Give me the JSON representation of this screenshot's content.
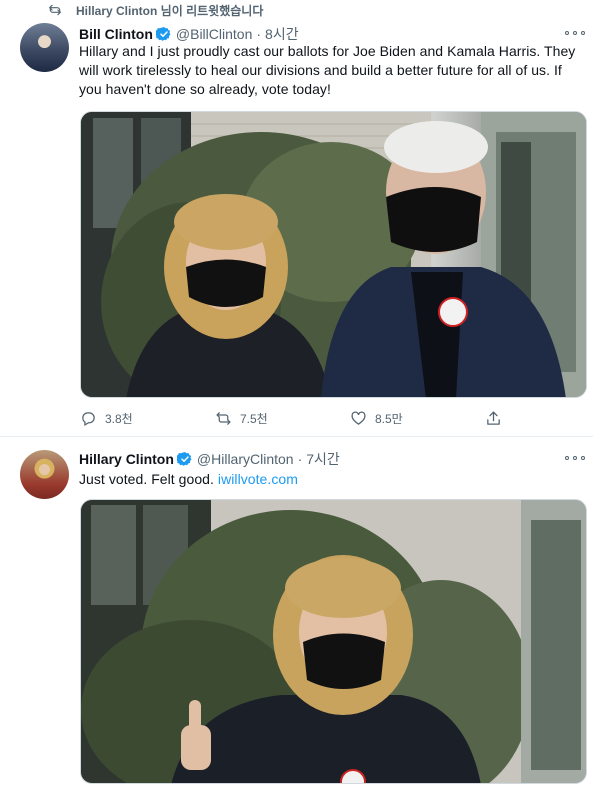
{
  "retweet_notice": {
    "text": "Hillary Clinton 님이 리트윗했습니다",
    "icon": "retweet-icon"
  },
  "tweets": [
    {
      "author_name": "Bill Clinton",
      "handle": "@BillClinton",
      "separator": "·",
      "time": "8시간",
      "verified": true,
      "text": "Hillary and I just proudly cast our ballots for Joe Biden and Kamala Harris. They will work tirelessly to heal our divisions and build a better future for all of us. If you haven't done so already, vote today!",
      "photo_alt": "Hillary and Bill Clinton wearing black masks and 'I Voted' stickers outdoors",
      "actions": {
        "replies": "3.8천",
        "retweets": "7.5천",
        "likes": "8.5만"
      }
    },
    {
      "author_name": "Hillary Clinton",
      "handle": "@HillaryClinton",
      "separator": "·",
      "time": "7시간",
      "verified": true,
      "text_plain": "Just voted. Felt good.",
      "text_link": "iwillvote.com",
      "photo_alt": "Hillary Clinton in a black mask giving a thumbs up"
    }
  ],
  "colors": {
    "accent": "#1d9bf0",
    "muted": "#536471",
    "text": "#0f1419",
    "divider": "#e6ecf0"
  }
}
